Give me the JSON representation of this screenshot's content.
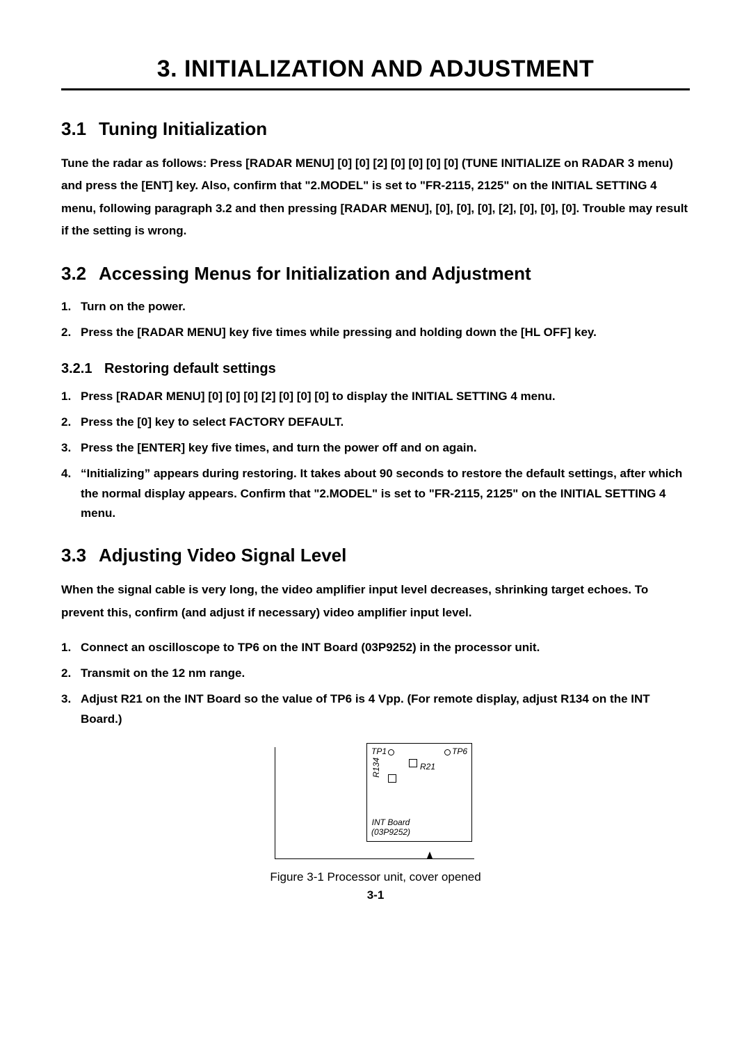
{
  "chapter": {
    "number": "3.",
    "title": "INITIALIZATION AND ADJUSTMENT"
  },
  "s31": {
    "num": "3.1",
    "title": "Tuning Initialization",
    "body": "Tune the radar as follows: Press [RADAR MENU] [0] [0] [2] [0] [0] [0] [0] (TUNE INITIALIZE on RADAR 3 menu) and press the [ENT] key. Also, confirm that \"2.MODEL\" is set to \"FR-2115, 2125\" on the INITIAL SETTING 4 menu, following paragraph 3.2 and then pressing [RADAR MENU], [0], [0], [0], [2], [0], [0], [0]. Trouble may result if the setting is wrong."
  },
  "s32": {
    "num": "3.2",
    "title": "Accessing Menus for Initialization and Adjustment",
    "steps": [
      "Turn on the power.",
      "Press the [RADAR MENU] key five times while pressing and holding down the [HL OFF] key."
    ]
  },
  "s321": {
    "num": "3.2.1",
    "title": "Restoring default settings",
    "steps": [
      "Press [RADAR MENU] [0] [0] [0] [2] [0] [0] [0] to display the INITIAL SETTING 4 menu.",
      "Press the [0] key to select FACTORY DEFAULT.",
      "Press the [ENTER] key five times, and turn the power off and on again.",
      "“Initializing” appears during restoring. It takes about 90 seconds to restore the default settings, after which the normal display appears. Confirm that \"2.MODEL\" is set to \"FR-2115, 2125\" on the INITIAL SETTING 4 menu."
    ]
  },
  "s33": {
    "num": "3.3",
    "title": "Adjusting Video Signal Level",
    "body": "When the signal cable is very long, the video amplifier input level decreases, shrinking target echoes. To prevent this, confirm (and adjust if necessary) video amplifier input level.",
    "steps": [
      "Connect an oscilloscope to TP6 on the INT Board (03P9252) in the processor unit.",
      "Transmit on the 12 nm range.",
      "Adjust R21 on the INT Board so the value of TP6 is 4 Vpp. (For remote display, adjust R134 on the INT Board.)"
    ]
  },
  "figure": {
    "tp1": "TP1",
    "tp6": "TP6",
    "r21": "R21",
    "r134": "R134",
    "board1": "INT Board",
    "board2": "(03P9252)",
    "caption": "Figure 3-1 Processor unit, cover opened"
  },
  "pageNumber": "3-1"
}
